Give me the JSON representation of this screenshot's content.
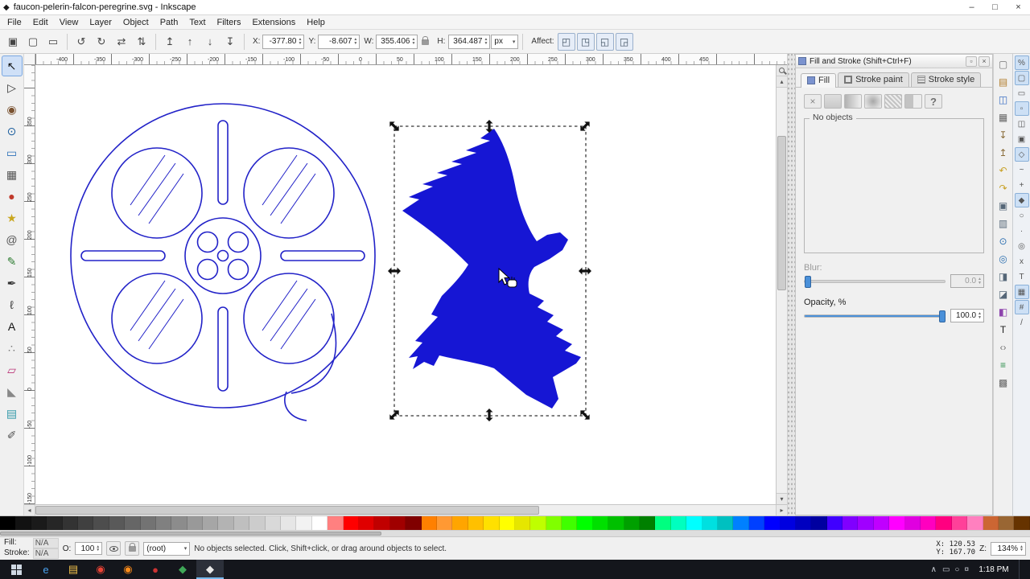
{
  "glyphs": {
    "up": "▲",
    "down": "▼",
    "dropdown": "▾",
    "left": "◂",
    "right": "▸",
    "uparrow": "▴",
    "downarrow": "▾",
    "tray_arrow": "∧",
    "panel_dock": "▫",
    "panel_close": "×",
    "app_diamond": "◆"
  },
  "window": {
    "title": "faucon-pelerin-falcon-peregrine.svg - Inkscape",
    "minimize": "–",
    "maximize": "□",
    "close": "×"
  },
  "menu": {
    "items": [
      {
        "label": "File"
      },
      {
        "label": "Edit"
      },
      {
        "label": "View"
      },
      {
        "label": "Layer"
      },
      {
        "label": "Object"
      },
      {
        "label": "Path"
      },
      {
        "label": "Text"
      },
      {
        "label": "Filters"
      },
      {
        "label": "Extensions"
      },
      {
        "label": "Help"
      }
    ]
  },
  "sel_toolbar": {
    "select_icons": [
      {
        "n": "select-all",
        "g": "▣"
      },
      {
        "n": "select-all-layers",
        "g": "▢"
      },
      {
        "n": "deselect",
        "g": "▭"
      }
    ],
    "transform_icons": [
      {
        "n": "rotate-ccw",
        "g": "↺"
      },
      {
        "n": "rotate-cw",
        "g": "↻"
      },
      {
        "n": "flip-horizontal",
        "g": "⇄"
      },
      {
        "n": "flip-vertical",
        "g": "⇅"
      }
    ],
    "zorder_icons": [
      {
        "n": "raise-to-top",
        "g": "↥"
      },
      {
        "n": "raise",
        "g": "↑"
      },
      {
        "n": "lower",
        "g": "↓"
      },
      {
        "n": "lower-to-bottom",
        "g": "↧"
      }
    ],
    "fields": [
      {
        "label": "X:",
        "value": "-377.80"
      },
      {
        "label": "Y:",
        "value": "-8.607"
      },
      {
        "label": "W:",
        "value": "355.406"
      }
    ],
    "h_field": {
      "label": "H:",
      "value": "364.487"
    },
    "unit": "px",
    "affect_label": "Affect:",
    "affect_icons": [
      {
        "n": "move-gradients-toggle",
        "g": "◰"
      },
      {
        "n": "move-patterns-toggle",
        "g": "◳"
      },
      {
        "n": "move-clips-toggle",
        "g": "◱"
      },
      {
        "n": "transform-stroke-toggle",
        "g": "◲"
      }
    ]
  },
  "tools": [
    {
      "name": "selector",
      "g": "↖",
      "c": "#111111",
      "on": true
    },
    {
      "name": "node-editor",
      "g": "▷",
      "c": "#333333"
    },
    {
      "name": "tweak",
      "g": "◉",
      "c": "#7a5230"
    },
    {
      "name": "zoom",
      "g": "⊙",
      "c": "#1b5e9e"
    },
    {
      "name": "rectangle",
      "g": "▭",
      "c": "#2a6fb8"
    },
    {
      "name": "box-3d",
      "g": "▦",
      "c": "#555555"
    },
    {
      "name": "ellipse",
      "g": "●",
      "c": "#c0392b"
    },
    {
      "name": "star",
      "g": "★",
      "c": "#c9a61d"
    },
    {
      "name": "spiral",
      "g": "@",
      "c": "#555555"
    },
    {
      "name": "pencil",
      "g": "✎",
      "c": "#2e7d32"
    },
    {
      "name": "bezier-pen",
      "g": "✒",
      "c": "#333333"
    },
    {
      "name": "calligraphy",
      "g": "ℓ",
      "c": "#333333"
    },
    {
      "name": "text",
      "g": "A",
      "c": "#111111"
    },
    {
      "name": "spray",
      "g": "∴",
      "c": "#777777"
    },
    {
      "name": "eraser",
      "g": "▱",
      "c": "#bb3377"
    },
    {
      "name": "paint-bucket",
      "g": "◣",
      "c": "#888888"
    },
    {
      "name": "gradient",
      "g": "▤",
      "c": "#3399aa"
    },
    {
      "name": "dropper",
      "g": "✐",
      "c": "#555555"
    }
  ],
  "rulers": {
    "h_labels": [
      {
        "t": "-400"
      },
      {
        "t": "-350"
      },
      {
        "t": "-300"
      },
      {
        "t": "-250"
      },
      {
        "t": "-200"
      },
      {
        "t": "-150"
      },
      {
        "t": "-100"
      },
      {
        "t": "-50"
      },
      {
        "t": "0"
      },
      {
        "t": "50"
      },
      {
        "t": "100"
      },
      {
        "t": "150"
      },
      {
        "t": "200"
      },
      {
        "t": "250"
      },
      {
        "t": "300"
      },
      {
        "t": "350"
      },
      {
        "t": "400"
      },
      {
        "t": "450"
      }
    ],
    "v_labels": [
      {
        "t": "-150"
      },
      {
        "t": "-100"
      },
      {
        "t": "-50"
      },
      {
        "t": "0"
      },
      {
        "t": "50"
      },
      {
        "t": "100"
      },
      {
        "t": "150"
      },
      {
        "t": "200"
      },
      {
        "t": "250"
      },
      {
        "t": "300"
      },
      {
        "t": "350"
      }
    ]
  },
  "panel": {
    "title": "Fill and Stroke (Shift+Ctrl+F)",
    "tabs": [
      {
        "label": "Fill",
        "k": "active",
        "ti": "ti-fill"
      },
      {
        "label": "Stroke paint",
        "ti": "ti-stroke"
      },
      {
        "label": "Stroke style",
        "ti": "ti-style"
      }
    ],
    "paint_buttons": [
      {
        "n": "no-paint",
        "g": "×",
        "k": "pk-x"
      },
      {
        "n": "flat-color",
        "k": "pk-flat"
      },
      {
        "n": "linear-gradient",
        "k": "pk-lin"
      },
      {
        "n": "radial-gradient",
        "k": "pk-rad"
      },
      {
        "n": "pattern",
        "k": "pk-pat"
      },
      {
        "n": "swatch",
        "k": "pk-sw"
      },
      {
        "n": "unknown-paint",
        "g": "?",
        "k": "pk-q"
      }
    ],
    "no_objects": "No objects",
    "blur_label": "Blur:",
    "blur_value": "0.0",
    "opacity_label": "Opacity, %",
    "opacity_value": "100.0"
  },
  "commands_bar": [
    {
      "n": "new-document",
      "g": "▢",
      "c": "#777777"
    },
    {
      "n": "open-document",
      "g": "▤",
      "c": "#b07c2a"
    },
    {
      "n": "save-document",
      "g": "◫",
      "c": "#3a6fc4"
    },
    {
      "n": "print",
      "g": "▦",
      "c": "#666666"
    },
    {
      "n": "import",
      "g": "↧",
      "c": "#8a6d3b"
    },
    {
      "n": "export",
      "g": "↥",
      "c": "#8a6d3b"
    },
    {
      "n": "undo",
      "g": "↶",
      "c": "#c9a227"
    },
    {
      "n": "redo",
      "g": "↷",
      "c": "#c9a227"
    },
    {
      "n": "copy",
      "g": "▣",
      "c": "#556677"
    },
    {
      "n": "paste",
      "g": "▥",
      "c": "#556677"
    },
    {
      "n": "zoom-drawing",
      "g": "⊙",
      "c": "#2c6fb0"
    },
    {
      "n": "zoom-page",
      "g": "◎",
      "c": "#2c6fb0"
    },
    {
      "n": "duplicate",
      "g": "◨",
      "c": "#556677"
    },
    {
      "n": "clone",
      "g": "◪",
      "c": "#556677"
    },
    {
      "n": "fill-stroke-dialog",
      "g": "◧",
      "c": "#8e44ad"
    },
    {
      "n": "text-dialog",
      "g": "T",
      "c": "#222222"
    },
    {
      "n": "xml-editor",
      "g": "‹›",
      "c": "#777777"
    },
    {
      "n": "align-dialog",
      "g": "≡",
      "c": "#2c8c4a"
    },
    {
      "n": "document-properties",
      "g": "▩",
      "c": "#666666"
    }
  ],
  "snap_bar": [
    {
      "n": "snap-enable",
      "g": "%",
      "on": true
    },
    {
      "n": "snap-bbox",
      "g": "▢",
      "on": true
    },
    {
      "n": "snap-bbox-edge",
      "g": "▭"
    },
    {
      "n": "snap-bbox-corner",
      "g": "▫",
      "on": true
    },
    {
      "n": "snap-bbox-edge-mid",
      "g": "◫"
    },
    {
      "n": "snap-bbox-center",
      "g": "▣"
    },
    {
      "n": "snap-nodes",
      "g": "◇",
      "on": true
    },
    {
      "n": "snap-path",
      "g": "~"
    },
    {
      "n": "snap-path-intersection",
      "g": "+"
    },
    {
      "n": "snap-cusp-node",
      "g": "◆",
      "on": true
    },
    {
      "n": "snap-smooth-node",
      "g": "○"
    },
    {
      "n": "snap-midpoint",
      "g": "·"
    },
    {
      "n": "snap-object-center",
      "g": "◎"
    },
    {
      "n": "snap-rotation-center",
      "g": "x"
    },
    {
      "n": "snap-text-baseline",
      "g": "T"
    },
    {
      "n": "snap-page-border",
      "g": "▦",
      "on": true
    },
    {
      "n": "snap-grid",
      "g": "#",
      "on": true
    },
    {
      "n": "snap-guide",
      "g": "/"
    }
  ],
  "palette": {
    "colors": [
      {
        "c": "#000000"
      },
      {
        "c": "#121212"
      },
      {
        "c": "#1a1a1a"
      },
      {
        "c": "#262626"
      },
      {
        "c": "#333333"
      },
      {
        "c": "#404040"
      },
      {
        "c": "#4d4d4d"
      },
      {
        "c": "#595959"
      },
      {
        "c": "#666666"
      },
      {
        "c": "#737373"
      },
      {
        "c": "#808080"
      },
      {
        "c": "#8c8c8c"
      },
      {
        "c": "#999999"
      },
      {
        "c": "#a6a6a6"
      },
      {
        "c": "#b3b3b3"
      },
      {
        "c": "#bfbfbf"
      },
      {
        "c": "#cccccc"
      },
      {
        "c": "#d9d9d9"
      },
      {
        "c": "#e6e6e6"
      },
      {
        "c": "#f2f2f2"
      },
      {
        "c": "#ffffff"
      },
      {
        "c": "#ff8080"
      },
      {
        "c": "#ff0000"
      },
      {
        "c": "#e00000"
      },
      {
        "c": "#c00000"
      },
      {
        "c": "#a00000"
      },
      {
        "c": "#800000"
      },
      {
        "c": "#ff8000"
      },
      {
        "c": "#ff9933"
      },
      {
        "c": "#ffa500"
      },
      {
        "c": "#ffc000"
      },
      {
        "c": "#ffe000"
      },
      {
        "c": "#ffff00"
      },
      {
        "c": "#e6e600"
      },
      {
        "c": "#bfff00"
      },
      {
        "c": "#80ff00"
      },
      {
        "c": "#40ff00"
      },
      {
        "c": "#00ff00"
      },
      {
        "c": "#00e000"
      },
      {
        "c": "#00c000"
      },
      {
        "c": "#00a000"
      },
      {
        "c": "#008000"
      },
      {
        "c": "#00ff80"
      },
      {
        "c": "#00ffbf"
      },
      {
        "c": "#00ffff"
      },
      {
        "c": "#00e0e0"
      },
      {
        "c": "#00c0c0"
      },
      {
        "c": "#0080ff"
      },
      {
        "c": "#0040ff"
      },
      {
        "c": "#0000ff"
      },
      {
        "c": "#0000e0"
      },
      {
        "c": "#0000c0"
      },
      {
        "c": "#0000a0"
      },
      {
        "c": "#4000ff"
      },
      {
        "c": "#8000ff"
      },
      {
        "c": "#a000ff"
      },
      {
        "c": "#c000ff"
      },
      {
        "c": "#ff00ff"
      },
      {
        "c": "#e000e0"
      },
      {
        "c": "#ff00bf"
      },
      {
        "c": "#ff0080"
      },
      {
        "c": "#ff4099"
      },
      {
        "c": "#ff80bf"
      },
      {
        "c": "#cc6633"
      },
      {
        "c": "#996633"
      },
      {
        "c": "#663300"
      }
    ]
  },
  "status": {
    "fill_label": "Fill:",
    "fill_value": "N/A",
    "stroke_label": "Stroke:",
    "stroke_value": "N/A",
    "o_label": "O:",
    "o_value": "100",
    "layer": "(root)",
    "message": "No objects selected. Click, Shift+click, or drag around objects to select.",
    "x_value": "X: 120.53",
    "y_value": "Y: 167.70",
    "z_label": "Z:",
    "zoom": "134%"
  },
  "taskbar": {
    "apps": [
      {
        "n": "edge",
        "g": "e",
        "c": "#4aa3f0"
      },
      {
        "n": "file-explorer",
        "g": "▤",
        "c": "#f0c14b"
      },
      {
        "n": "chrome",
        "g": "◉",
        "c": "#ea4335"
      },
      {
        "n": "firefox",
        "g": "◉",
        "c": "#ff8c1a"
      },
      {
        "n": "opera",
        "g": "●",
        "c": "#cc3333"
      },
      {
        "n": "defender",
        "g": "◆",
        "c": "#3fa757"
      },
      {
        "n": "inkscape",
        "g": "◆",
        "c": "#e8e8e8",
        "active": true
      }
    ],
    "tray_icons": [
      {
        "g": "▭"
      },
      {
        "g": "○"
      },
      {
        "g": "¤"
      }
    ],
    "time": "1:18 PM"
  },
  "drawing": {
    "falcon_fill": "#1616d4",
    "reel_stroke": "#2222c8"
  }
}
